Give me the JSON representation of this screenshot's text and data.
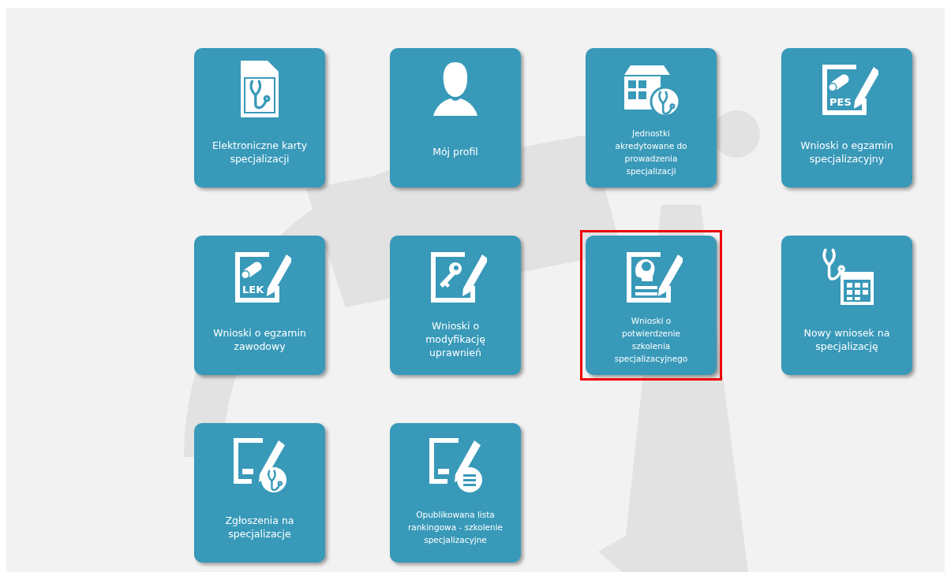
{
  "tiles": [
    {
      "kind": "card-stethoscope",
      "label": "Elektroniczne karty specjalizacji",
      "highlighted": false
    },
    {
      "kind": "person",
      "label": "Mój profil",
      "highlighted": false
    },
    {
      "kind": "building-stethoscope",
      "label": "Jednostki akredytowane do prowadzenia specjalizacji",
      "highlighted": false
    },
    {
      "kind": "document-scroll",
      "badge": "PES",
      "label": "Wnioski o egzamin specjalizacyjny",
      "highlighted": false
    },
    {
      "kind": "document-scroll",
      "badge": "LEK",
      "label": "Wnioski o egzamin zawodowy",
      "highlighted": false
    },
    {
      "kind": "document-key",
      "label": "Wnioski o modyfikację uprawnień",
      "highlighted": false
    },
    {
      "kind": "document-head",
      "label": "Wnioski o potwierdzenie szkolenia specjalizacyjnego",
      "highlighted": true
    },
    {
      "kind": "stethoscope-calendar",
      "label": "Nowy wniosek na specjalizację",
      "highlighted": false
    },
    {
      "kind": "document-stethoscope",
      "label": "Zgłoszenia na specjalizacje",
      "highlighted": false
    },
    {
      "kind": "document-list",
      "label": "Opublikowana lista rankingowa - szkolenie specjalizacyjne",
      "highlighted": false
    }
  ]
}
